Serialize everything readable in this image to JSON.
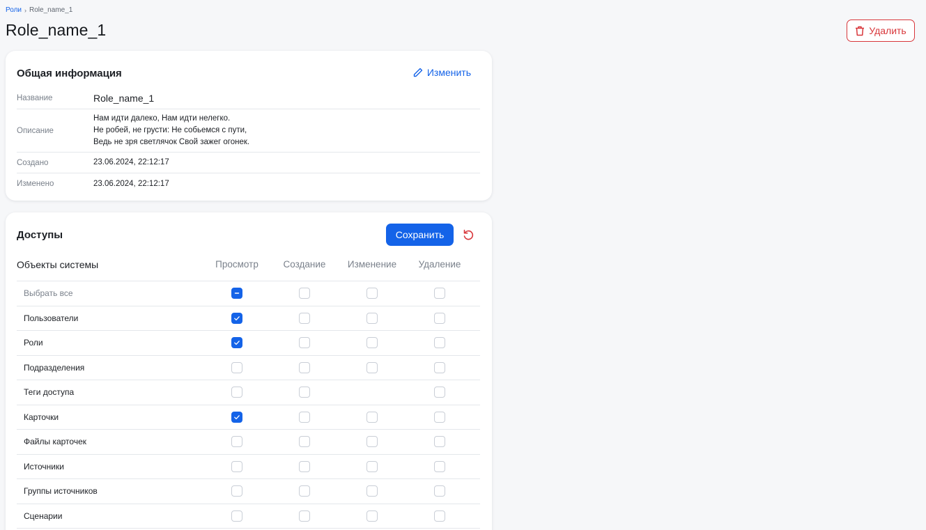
{
  "breadcrumb": {
    "parent": "Роли",
    "current": "Role_name_1"
  },
  "page_title": "Role_name_1",
  "delete_label": "Удалить",
  "info": {
    "title": "Общая информация",
    "edit_label": "Изменить",
    "rows": [
      {
        "label": "Название",
        "value": "Role_name_1"
      },
      {
        "label": "Описание",
        "lines": [
          "Нам идти далеко, Нам идти нелегко.",
          "Не робей, не грусти: Не собьемся с пути,",
          "Ведь не зря светлячок Свой зажег огонек."
        ]
      },
      {
        "label": "Создано",
        "value": "23.06.2024, 22:12:17"
      },
      {
        "label": "Изменено",
        "value": "23.06.2024, 22:12:17"
      }
    ]
  },
  "access": {
    "title": "Доступы",
    "save_label": "Сохранить",
    "objects_label": "Объекты системы",
    "columns": [
      "Просмотр",
      "Создание",
      "Изменение",
      "Удаление"
    ],
    "rows": [
      {
        "name": "Выбрать все",
        "view": "partial",
        "create": "off",
        "edit": "off",
        "delete": "off"
      },
      {
        "name": "Пользователи",
        "view": "on",
        "create": "off",
        "edit": "off",
        "delete": "off"
      },
      {
        "name": "Роли",
        "view": "on",
        "create": "off",
        "edit": "off",
        "delete": "off"
      },
      {
        "name": "Подразделения",
        "view": "off",
        "create": "off",
        "edit": "off",
        "delete": "off"
      },
      {
        "name": "Теги доступа",
        "view": "off",
        "create": "off",
        "edit": "none",
        "delete": "off"
      },
      {
        "name": "Карточки",
        "view": "on",
        "create": "off",
        "edit": "off",
        "delete": "off"
      },
      {
        "name": "Файлы карточек",
        "view": "off",
        "create": "off",
        "edit": "off",
        "delete": "off"
      },
      {
        "name": "Источники",
        "view": "off",
        "create": "off",
        "edit": "off",
        "delete": "off"
      },
      {
        "name": "Группы источников",
        "view": "off",
        "create": "off",
        "edit": "off",
        "delete": "off"
      },
      {
        "name": "Сценарии",
        "view": "off",
        "create": "off",
        "edit": "off",
        "delete": "off"
      }
    ]
  },
  "colors": {
    "accent": "#1463e8",
    "danger": "#d8363a"
  }
}
